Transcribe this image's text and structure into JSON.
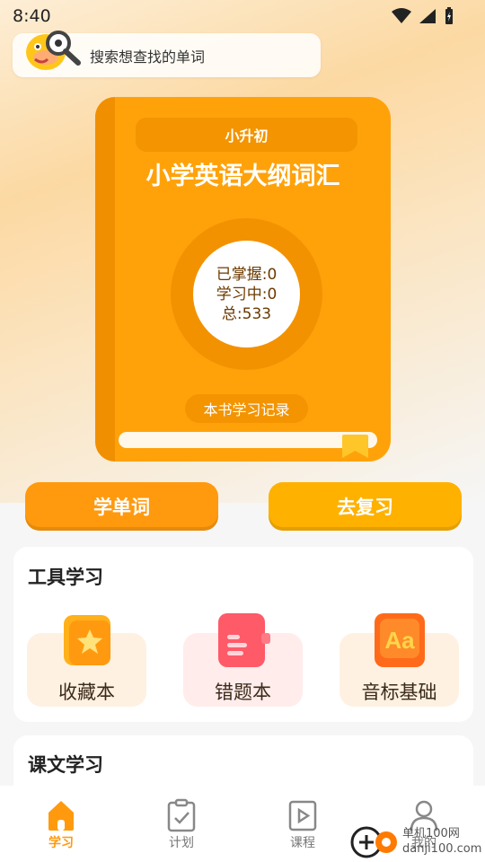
{
  "status": {
    "time": "8:40"
  },
  "search": {
    "placeholder": "搜索想查找的单词"
  },
  "book": {
    "tag": "小升初",
    "title": "小学英语大纲词汇",
    "mastered": "已掌握:0",
    "learning": "学习中:0",
    "total": "总:533",
    "record_label": "本书学习记录"
  },
  "actions": {
    "learn_label": "学单词",
    "review_label": "去复习"
  },
  "tools": {
    "title": "工具学习",
    "items": [
      {
        "label": "收藏本",
        "icon": "star-icon"
      },
      {
        "label": "错题本",
        "icon": "notebook-icon"
      },
      {
        "label": "音标基础",
        "icon": "aa-icon"
      }
    ]
  },
  "lesson": {
    "title": "课文学习"
  },
  "tabs": [
    {
      "label": "学习",
      "icon": "home-icon",
      "active": true
    },
    {
      "label": "计划",
      "icon": "clipboard-icon",
      "active": false
    },
    {
      "label": "课程",
      "icon": "play-icon",
      "active": false
    },
    {
      "label": "我的",
      "icon": "user-icon",
      "active": false
    }
  ],
  "watermark": {
    "line1": "单机100网",
    "line2": "danji100.com"
  },
  "colors": {
    "accent": "#ff9a0e",
    "book": "#ffa20a",
    "review": "#ffb100"
  }
}
